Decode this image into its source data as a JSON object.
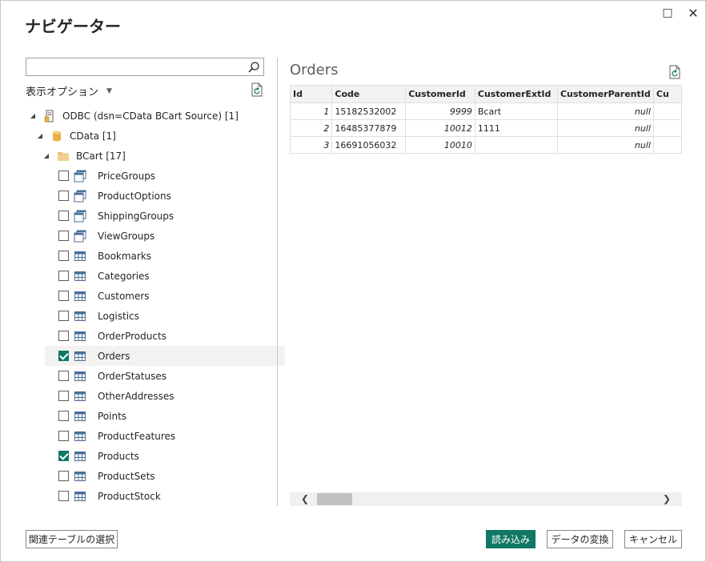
{
  "window": {
    "title": "ナビゲーター",
    "maximize_icon": "□",
    "close_icon": "✕"
  },
  "left": {
    "search_placeholder": "",
    "display_options": "表示オプション",
    "tree": {
      "source": {
        "label": "ODBC (dsn=CData BCart Source) [1]"
      },
      "database": {
        "label": "CData [1]"
      },
      "schema": {
        "label": "BCart [17]"
      },
      "items": [
        {
          "label": "PriceGroups",
          "type": "view",
          "checked": false
        },
        {
          "label": "ProductOptions",
          "type": "view",
          "checked": false
        },
        {
          "label": "ShippingGroups",
          "type": "view",
          "checked": false
        },
        {
          "label": "ViewGroups",
          "type": "view",
          "checked": false
        },
        {
          "label": "Bookmarks",
          "type": "table",
          "checked": false
        },
        {
          "label": "Categories",
          "type": "table",
          "checked": false
        },
        {
          "label": "Customers",
          "type": "table",
          "checked": false
        },
        {
          "label": "Logistics",
          "type": "table",
          "checked": false
        },
        {
          "label": "OrderProducts",
          "type": "table",
          "checked": false
        },
        {
          "label": "Orders",
          "type": "table",
          "checked": true,
          "selected": true
        },
        {
          "label": "OrderStatuses",
          "type": "table",
          "checked": false
        },
        {
          "label": "OtherAddresses",
          "type": "table",
          "checked": false
        },
        {
          "label": "Points",
          "type": "table",
          "checked": false
        },
        {
          "label": "ProductFeatures",
          "type": "table",
          "checked": false
        },
        {
          "label": "Products",
          "type": "table",
          "checked": true
        },
        {
          "label": "ProductSets",
          "type": "table",
          "checked": false
        },
        {
          "label": "ProductStock",
          "type": "table",
          "checked": false
        }
      ]
    }
  },
  "preview": {
    "title": "Orders",
    "columns": [
      "Id",
      "Code",
      "CustomerId",
      "CustomerExtId",
      "CustomerParentId",
      "Cu"
    ],
    "rows": [
      [
        "1",
        "15182532002",
        "9999",
        "Bcart",
        "null",
        ""
      ],
      [
        "2",
        "16485377879",
        "10012",
        "1111",
        "null",
        ""
      ],
      [
        "3",
        "16691056032",
        "10010",
        "",
        "null",
        ""
      ]
    ]
  },
  "footer": {
    "related_tables": "関連テーブルの選択",
    "load": "読み込み",
    "transform": "データの変換",
    "cancel": "キャンセル"
  },
  "colors": {
    "accent": "#117865",
    "folder": "#e8c27a",
    "db": "#e8b04a"
  }
}
